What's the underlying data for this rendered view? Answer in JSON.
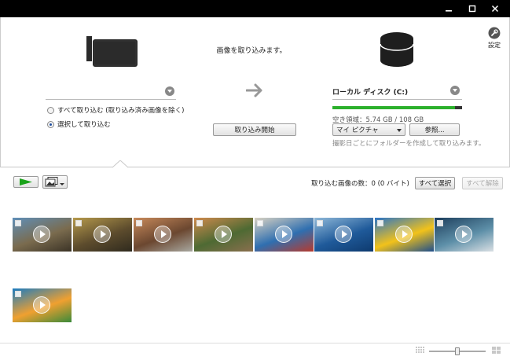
{
  "window": {
    "controls": [
      "minimize-icon",
      "maximize-icon",
      "close-icon"
    ]
  },
  "settings": {
    "label": "設定",
    "icon": "wrench-icon"
  },
  "header": {
    "message": "画像を取り込みます。"
  },
  "source": {
    "device_icon": "video-camera-icon",
    "options": [
      {
        "label": "すべて取り込む (取り込み済み画像を除く)",
        "selected": false
      },
      {
        "label": "選択して取り込む",
        "selected": true
      }
    ]
  },
  "import_button": {
    "label": "取り込み開始"
  },
  "destination": {
    "disk_icon": "hard-disk-icon",
    "disk_name": "ローカル ディスク (C:)",
    "free_space": "空き領域：5.74 GB / 108 GB",
    "used_fraction": 0.947,
    "folder": "マイ ピクチャ",
    "browse_label": "参照...",
    "hint": "撮影日ごとにフォルダーを作成して取り込みます。"
  },
  "toolbar": {
    "play_icon": "play-icon",
    "view_icon": "photo-stack-icon",
    "count_text": "取り込む画像の数：0 (0 バイト)",
    "select_all": "すべて選択",
    "deselect_all": "すべて解除"
  },
  "thumbnails": [
    {
      "name": "clip-1",
      "colors": [
        "#5f8fb8",
        "#7a6b4e",
        "#3b3326"
      ]
    },
    {
      "name": "clip-2",
      "colors": [
        "#b69a4c",
        "#5d4c2d",
        "#2f2a1e"
      ]
    },
    {
      "name": "clip-3",
      "colors": [
        "#c88a5b",
        "#6b4730",
        "#a8a8a0"
      ]
    },
    {
      "name": "clip-4",
      "colors": [
        "#cf8a4d",
        "#4e6a33",
        "#8a6f4e"
      ]
    },
    {
      "name": "clip-5",
      "colors": [
        "#d9d2c2",
        "#2f6fb0",
        "#b73a2e"
      ]
    },
    {
      "name": "clip-6",
      "colors": [
        "#8fb8d8",
        "#1f5a9a",
        "#0e3a6e"
      ]
    },
    {
      "name": "clip-7",
      "colors": [
        "#2a74c8",
        "#f2c21a",
        "#1e4e8c"
      ]
    },
    {
      "name": "clip-8",
      "colors": [
        "#1d3e5c",
        "#5d8fa8",
        "#d9dfe3"
      ]
    },
    {
      "name": "clip-9",
      "colors": [
        "#1b7bc0",
        "#f0a030",
        "#3a8a3a"
      ]
    }
  ],
  "footer": {
    "zoom_level": 0.5,
    "small_icon": "grid-small-icon",
    "large_icon": "grid-large-icon"
  }
}
